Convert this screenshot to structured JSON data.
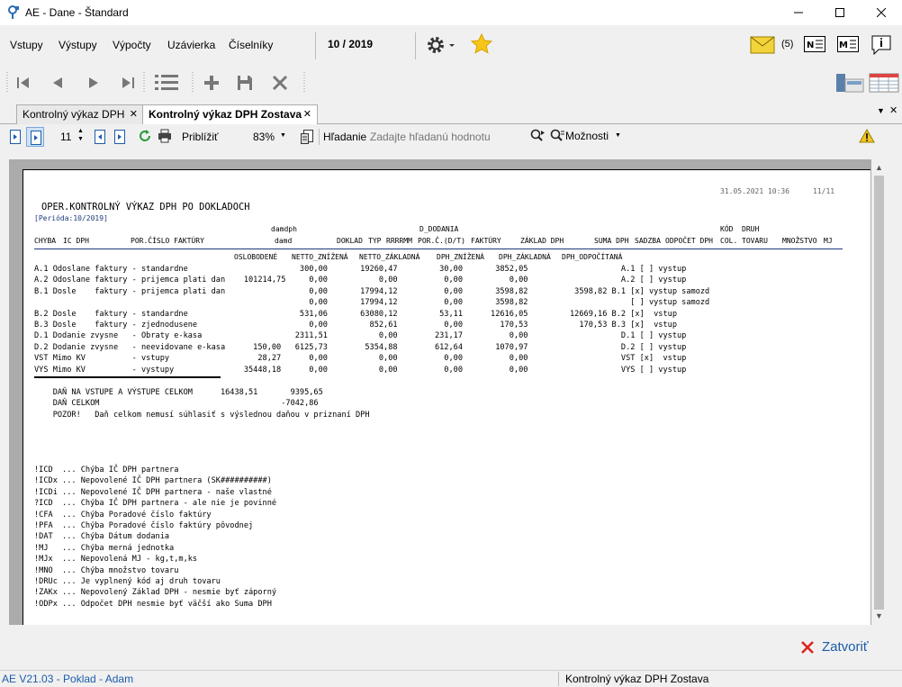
{
  "window": {
    "title": "AE - Dane - Štandard"
  },
  "menu": {
    "items": [
      "Vstupy",
      "Výstupy",
      "Výpočty",
      "Uzávierka",
      "Číselníky"
    ],
    "period": "10 / 2019",
    "mail_count": "(5)"
  },
  "tabs": [
    {
      "label": "Kontrolný výkaz DPH"
    },
    {
      "label": "Kontrolný výkaz DPH Zostava"
    }
  ],
  "report_toolbar": {
    "page": "11",
    "zoom_label": "Priblížiť",
    "zoom": "83%",
    "search_label": "Hľadanie",
    "search_placeholder": "Zadajte hľadanú hodnotu",
    "options_label": "Možnosti"
  },
  "report": {
    "date": "31.05.2021 10:36",
    "page": "11/11",
    "title": "OPER.KONTROLNÝ VÝKAZ DPH PO DOKLADOCH",
    "period": "[Perióda:10/2019]",
    "headers": {
      "chyba": "CHYBA",
      "ic_dph": "IC DPH",
      "por_cislo": "POR.ČÍSLO FAKTÚRY",
      "damdph": "damdph",
      "damd": "damd",
      "doklad": "DOKLAD",
      "typ": "TYP",
      "rrrrmm": "RRRRMM",
      "d_dodania": "D_DODANIA",
      "por_c_dt": "POR.Č.(D/T)",
      "faktury": "FAKTÚRY",
      "zaklad_dph": "ZÁKLAD DPH",
      "suma_dph": "SUMA DPH",
      "sadzba": "SADZBA",
      "odpocet_dph": "ODPOČET DPH",
      "kod": "KÓD",
      "col": "COL.",
      "druh": "DRUH",
      "tovaru": "TOVARU",
      "mnozstvo": "MNOŽSTVO",
      "mj": "MJ"
    },
    "subheaders": {
      "oslobodene": "OSLOBODENÉ",
      "netto_znizena": "NETTO_ZNÍŽENÁ",
      "netto_zakladna": "NETTO_ZÁKLADNÁ",
      "dph_znizena": "DPH_ZNÍŽENÁ",
      "dph_zakladna": "DPH_ZÁKLADNÁ",
      "dph_odpocitana": "DPH_ODPOČÍTANÁ"
    },
    "rows": [
      "A.1 Odoslane faktury - standardne                        300,00       19260,47         30,00       3852,05                    A.1 [ ] vystup",
      "A.2 Odoslane faktury - prijemca plati dan    101214,75     0,00           0,00          0,00          0,00                    A.2 [ ] vystup",
      "B.1 Dosle    faktury - prijemca plati dan                  0,00       17994,12          0,00       3598,82          3598,82 B.1 [x] vystup samozd",
      "                                                           0,00       17994,12          0,00       3598,82                      [ ] vystup samozd",
      "B.2 Dosle    faktury - standardne                        531,06       63080,12         53,11      12616,05         12669,16 B.2 [x]  vstup",
      "B.3 Dosle    faktury - zjednodusene                        0,00         852,61          0,00        170,53           170,53 B.3 [x]  vstup",
      "D.1 Dodanie zvysne   - Obraty e-kasa                    2311,51           0,00        231,17          0,00                    D.1 [ ] vystup",
      "D.2 Dodanie zvysne   - neevidovane e-kasa      150,00   6125,73        5354,88        612,64       1070,97                    D.2 [ ] vystup",
      "VST Mimo KV          - vstupy                   28,27      0,00           0,00          0,00          0,00                    VST [x]  vstup",
      "VYS Mimo KV          - vystupy               35448,18      0,00           0,00          0,00          0,00                    VYS [ ] vystup"
    ],
    "totals": [
      "    DAŇ NA VSTUPE A VÝSTUPE CELKOM      16438,51       9395,65",
      "    DAŇ CELKOM                                       -7042,86",
      "    POZOR!   Daň celkom nemusí súhlasiť s výslednou daňou v priznaní DPH"
    ],
    "legend": [
      "!ICD  ... Chýba IČ DPH partnera",
      "!ICDx ... Nepovolené IČ DPH partnera (SK##########)",
      "!ICDi ... Nepovolené IČ DPH partnera - naše vlastné",
      "?ICD  ... Chýba IČ DPH partnera - ale nie je povinné",
      "!CFA  ... Chýba Poradové číslo faktúry",
      "!PFA  ... Chýba Poradové číslo faktúry pôvodnej",
      "!DAT  ... Chýba Dátum dodania",
      "!MJ   ... Chýba merná jednotka",
      "!MJx  ... Nepovolená MJ - kg,t,m,ks",
      "!MNO  ... Chýba množstvo tovaru",
      "!DRUc ... Je vyplnený kód aj druh tovaru",
      "!ZAKx ... Nepovolený Základ DPH - nesmie byť záporný",
      "!ODPx ... Odpočet DPH nesmie byť väčší ako Suma DPH"
    ]
  },
  "footer": {
    "close_label": "Zatvoriť"
  },
  "status": {
    "left": "AE V21.03 - Poklad - Adam",
    "right": "Kontrolný výkaz DPH Zostava"
  },
  "colors": {
    "accent": "#1c5cab",
    "close_red": "#d9261c",
    "star": "#f5c518",
    "mail": "#f3d33a"
  }
}
